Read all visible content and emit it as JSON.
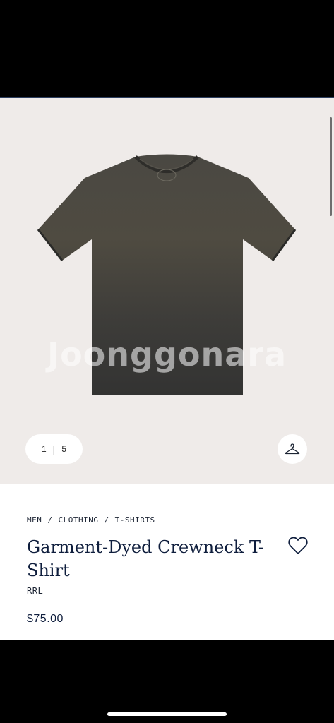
{
  "gallery": {
    "watermark": "Joonggonara",
    "pager": {
      "current": "1",
      "separator": "|",
      "total": "5"
    },
    "hanger_icon": "hanger-icon",
    "background_color": "#efebe9"
  },
  "product": {
    "breadcrumb": [
      "MEN",
      "CLOTHING",
      "T-SHIRTS"
    ],
    "breadcrumb_separator": "/",
    "title": "Garment-Dyed Crewneck T-Shirt",
    "brand": "RRL",
    "price": "$75.00",
    "favorite_icon": "heart-icon",
    "garment_color": "#3b3b38",
    "label_text": "RRL",
    "title_color": "#0f1e3d"
  }
}
